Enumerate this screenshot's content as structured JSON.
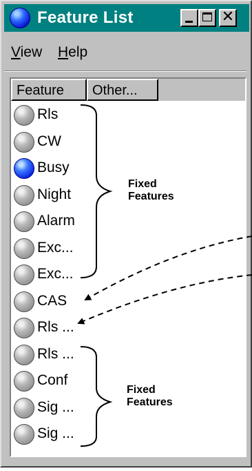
{
  "window": {
    "title": "Feature List"
  },
  "titlebar_buttons": {
    "minimize_icon": "minimize-icon",
    "maximize_icon": "maximize-icon",
    "close_glyph": "✕"
  },
  "menu": {
    "view": {
      "mnemonic": "V",
      "rest": "iew"
    },
    "help": {
      "mnemonic": "H",
      "rest": "elp"
    }
  },
  "columns": [
    "Feature",
    "Other..."
  ],
  "features": [
    {
      "label": "Rls",
      "status": "off"
    },
    {
      "label": "CW",
      "status": "off"
    },
    {
      "label": "Busy",
      "status": "on"
    },
    {
      "label": "Night",
      "status": "off"
    },
    {
      "label": "Alarm",
      "status": "off"
    },
    {
      "label": "Exc...",
      "status": "off"
    },
    {
      "label": "Exc...",
      "status": "off"
    },
    {
      "label": "CAS",
      "status": "off"
    },
    {
      "label": "Rls ...",
      "status": "off"
    },
    {
      "label": "Rls ...",
      "status": "off"
    },
    {
      "label": "Conf",
      "status": "off"
    },
    {
      "label": "Sig ...",
      "status": "off"
    },
    {
      "label": "Sig ...",
      "status": "off"
    }
  ],
  "annotations": {
    "group1": {
      "line1": "Fixed",
      "line2": "Features"
    },
    "group2": {
      "line1": "Fixed",
      "line2": "Features"
    }
  },
  "colors": {
    "title_bar": "#008080",
    "led_on": "#0010d8",
    "led_off": "#a0a0a0",
    "window_bg": "#c0c0c0"
  }
}
